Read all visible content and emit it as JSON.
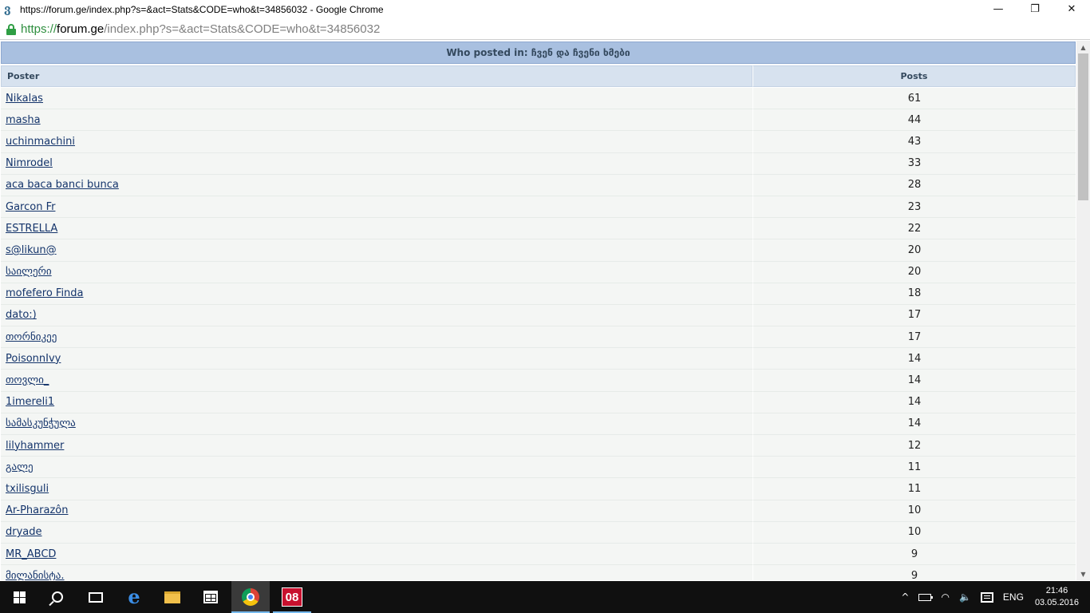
{
  "window": {
    "title": "https://forum.ge/index.php?s=&act=Stats&CODE=who&t=34856032 - Google Chrome",
    "minimize": "—",
    "restore": "❐",
    "close": "✕"
  },
  "address": {
    "scheme": "https://",
    "host": "forum.ge",
    "path": "/index.php?s=&act=Stats&CODE=who&t=34856032"
  },
  "table": {
    "title": "Who posted in: ჩვენ და ჩვენი ხმები",
    "col_poster": "Poster",
    "col_posts": "Posts",
    "rows": [
      {
        "poster": "Nikalas",
        "posts": "61"
      },
      {
        "poster": "masha",
        "posts": "44"
      },
      {
        "poster": "uchinmachini",
        "posts": "43"
      },
      {
        "poster": "Nimrodel",
        "posts": "33"
      },
      {
        "poster": "aca baca banci bunca",
        "posts": "28"
      },
      {
        "poster": "Garcon Fr",
        "posts": "23"
      },
      {
        "poster": "ESTRELLA",
        "posts": "22"
      },
      {
        "poster": "s@likun@",
        "posts": "20"
      },
      {
        "poster": "საილერი",
        "posts": "20"
      },
      {
        "poster": "mofefero Finda",
        "posts": "18"
      },
      {
        "poster": "dato:)",
        "posts": "17"
      },
      {
        "poster": "თორნიკეე",
        "posts": "17"
      },
      {
        "poster": "PoisonnIvy",
        "posts": "14"
      },
      {
        "poster": "თოვლი_",
        "posts": "14"
      },
      {
        "poster": "1imereli1",
        "posts": "14"
      },
      {
        "poster": "სამასკუნჭულა",
        "posts": "14"
      },
      {
        "poster": "lilyhammer",
        "posts": "12"
      },
      {
        "poster": "გალე",
        "posts": "11"
      },
      {
        "poster": "txilisguli",
        "posts": "11"
      },
      {
        "poster": "Ar-Pharazôn",
        "posts": "10"
      },
      {
        "poster": "dryade",
        "posts": "10"
      },
      {
        "poster": "MR_ABCD",
        "posts": "9"
      },
      {
        "poster": "მილანისტა.",
        "posts": "9"
      }
    ]
  },
  "taskbar": {
    "app08_label": "08",
    "lang": "ENG",
    "time": "21:46",
    "date": "03.05.2016",
    "tray_chevron": "^",
    "wifi": "◠",
    "volume": "🔈"
  }
}
